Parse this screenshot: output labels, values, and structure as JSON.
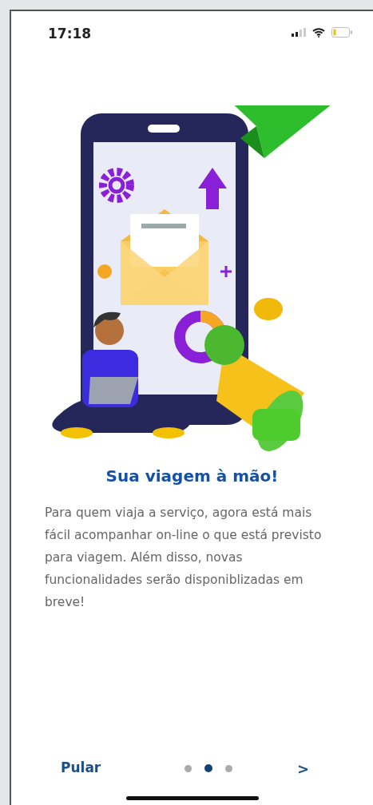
{
  "status_bar": {
    "time": "17:18"
  },
  "title": "Sua viagem à mão!",
  "body": "Para quem viaja a serviço, agora está mais fácil acompanhar on-line o que está previsto para viagem. Além disso, novas funcionalidades serão disponiblizadas em breve!",
  "footer": {
    "skip": "Pular",
    "next": ">",
    "pages": [
      {
        "selected": false
      },
      {
        "selected": true
      },
      {
        "selected": false
      }
    ]
  }
}
